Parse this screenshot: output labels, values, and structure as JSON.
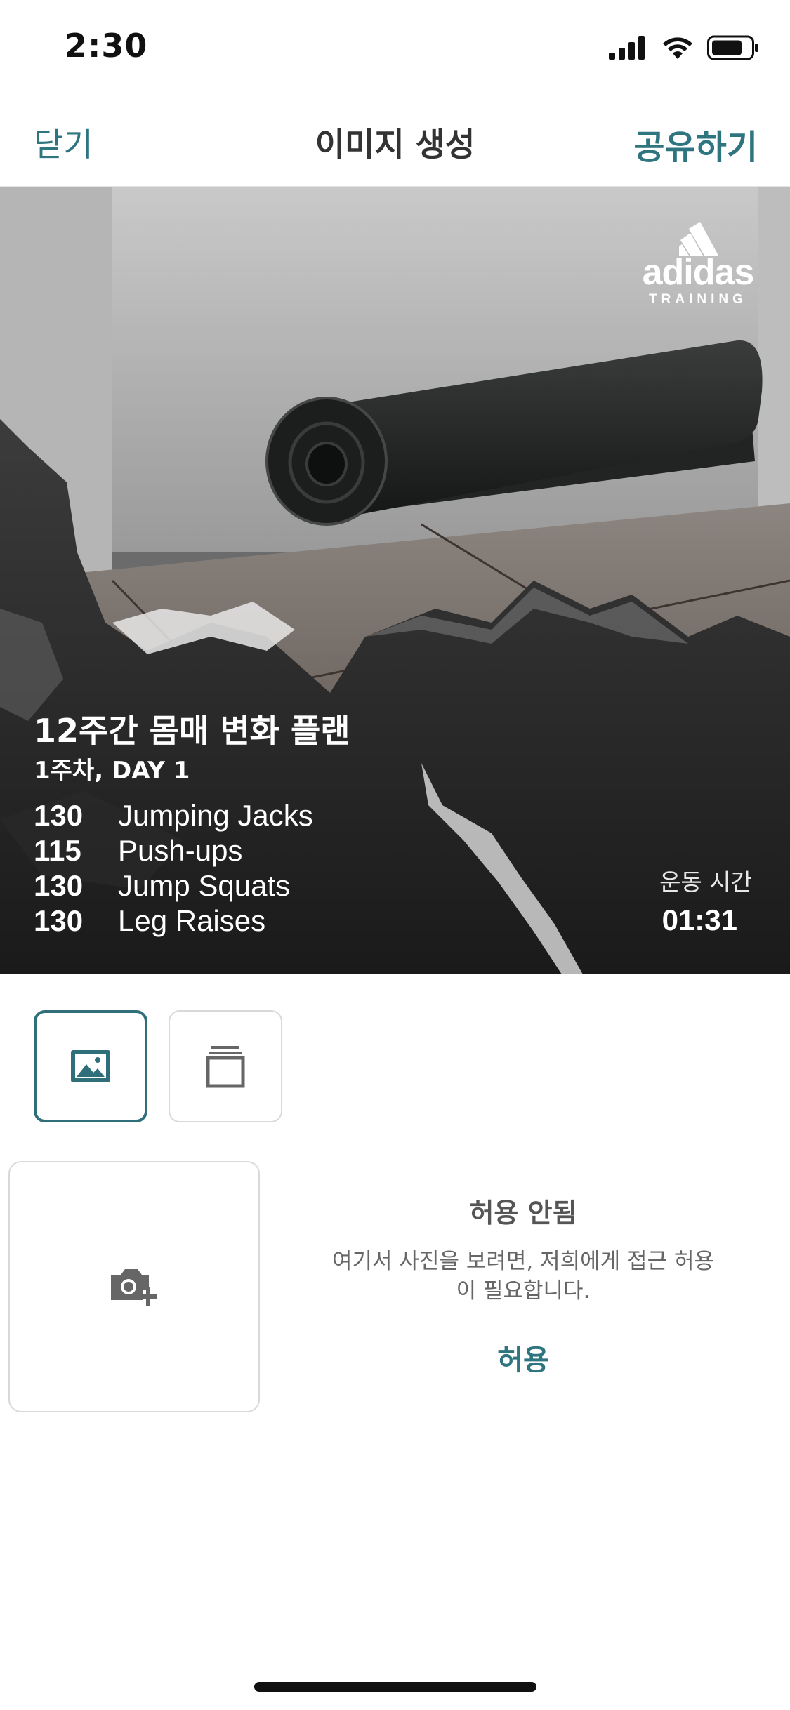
{
  "status_bar": {
    "time": "2:30"
  },
  "nav": {
    "close": "닫기",
    "title": "이미지 생성",
    "share": "공유하기"
  },
  "hero": {
    "brand": {
      "wordmark": "adidas",
      "sub": "TRAINING"
    },
    "plan_title": "12주간 몸매 변화 플랜",
    "plan_sub": "1주차, DAY 1",
    "exercises": [
      {
        "count": "130",
        "name": "Jumping Jacks"
      },
      {
        "count": "115",
        "name": "Push-ups"
      },
      {
        "count": "130",
        "name": "Jump Squats"
      },
      {
        "count": "130",
        "name": "Leg Raises"
      }
    ],
    "workout_time_label": "운동 시간",
    "workout_time": "01:31"
  },
  "templates": [
    {
      "icon": "image-icon",
      "selected": true
    },
    {
      "icon": "stack-icon",
      "selected": false
    }
  ],
  "gallery": {
    "camera_icon": "camera-plus-icon",
    "permission_title": "허용 안됨",
    "permission_message": "여기서 사진을 보려면, 저희에게 접근 허용이 필요합니다.",
    "permission_line1": "여기서 사진을 보려면, 저희에게 접근 허용",
    "permission_line2": "이 필요합니다.",
    "allow": "허용"
  },
  "colors": {
    "accent": "#2e7580",
    "text": "#333333",
    "border": "#d9d9d9"
  }
}
